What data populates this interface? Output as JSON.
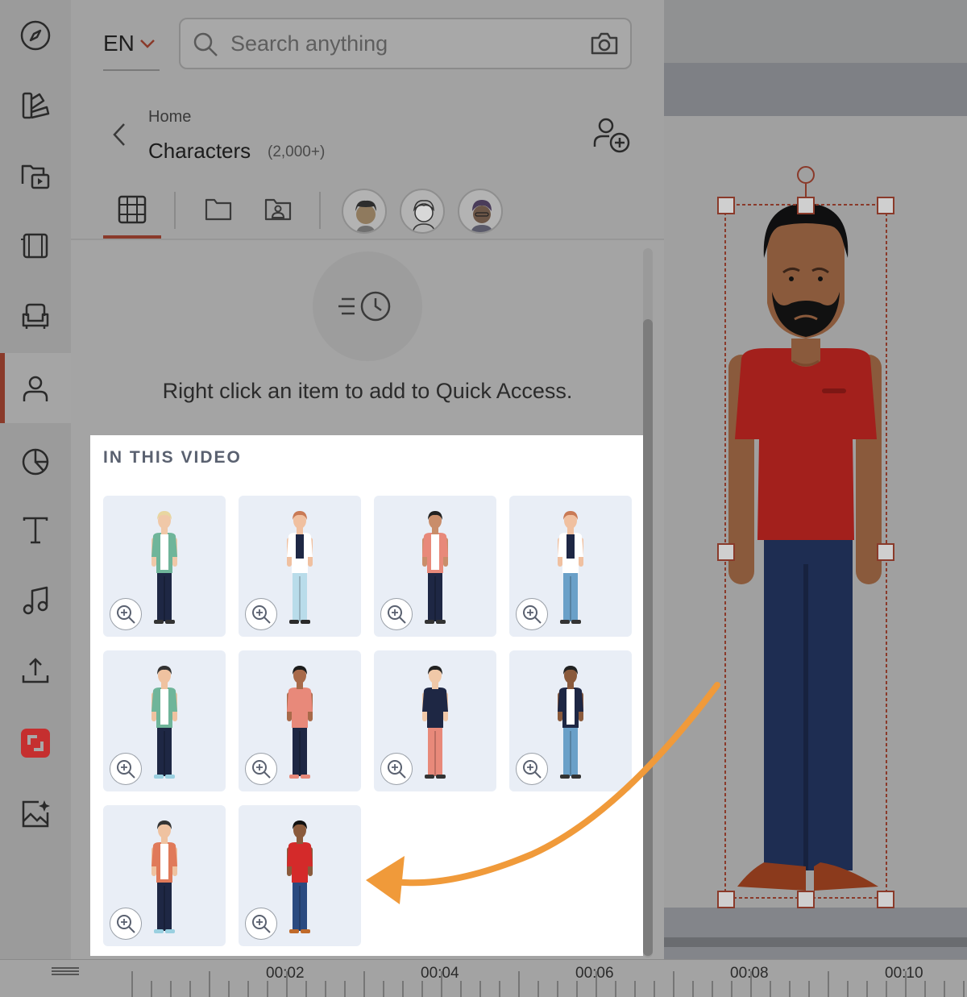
{
  "language": {
    "label": "EN"
  },
  "search": {
    "placeholder": "Search anything"
  },
  "breadcrumb": {
    "home": "Home",
    "title": "Characters",
    "count": "(2,000+)"
  },
  "quick_access": {
    "message": "Right click an item to add to Quick Access."
  },
  "section": {
    "title": "IN THIS VIDEO"
  },
  "timeline": {
    "ticks": [
      "00:02",
      "00:04",
      "00:06",
      "00:08",
      "00:10"
    ]
  },
  "colors": {
    "accent": "#8a3a2a",
    "arrow": "#f09a3a",
    "card_bg": "#e9eef6"
  },
  "rail_icons": [
    "compass-icon",
    "palette-icon",
    "video-folder-icon",
    "film-icon",
    "armchair-icon",
    "person-icon",
    "pie-chart-icon",
    "text-icon",
    "music-icon",
    "upload-icon",
    "brand-logo-icon",
    "ai-image-icon"
  ],
  "characters": [
    {
      "name": "character-blonde-man-green-blazer"
    },
    {
      "name": "character-woman-navy-vest"
    },
    {
      "name": "character-curly-woman-coral-jacket"
    },
    {
      "name": "character-man-navy-vest"
    },
    {
      "name": "character-glasses-man-green-blazer"
    },
    {
      "name": "character-curly-woman-coral-top"
    },
    {
      "name": "character-woman-navy-blouse"
    },
    {
      "name": "character-bearded-man-navy-blazer"
    },
    {
      "name": "character-glasses-woman-coral-blazer"
    },
    {
      "name": "character-bearded-man-red-shirt"
    }
  ]
}
